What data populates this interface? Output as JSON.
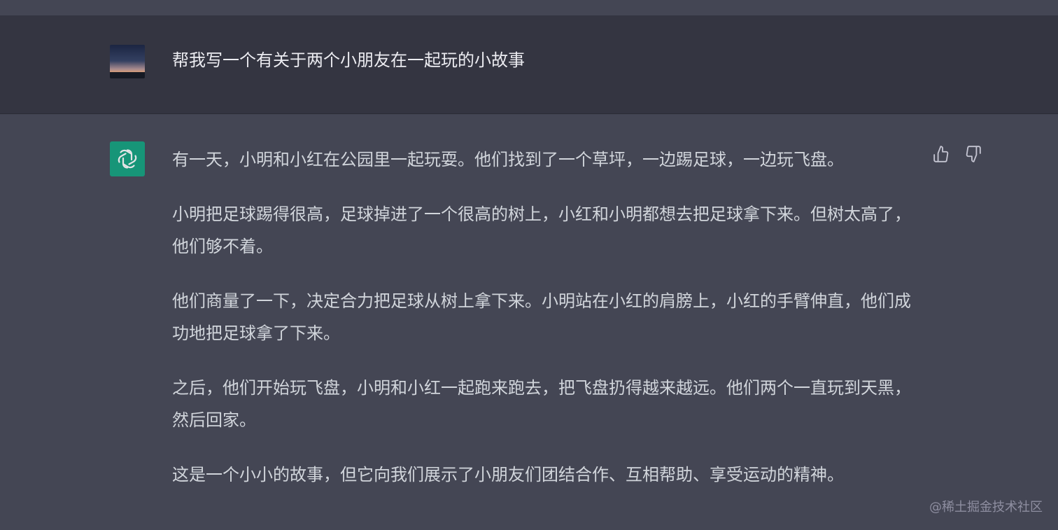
{
  "user_message": {
    "text": "帮我写一个有关于两个小朋友在一起玩的小故事",
    "avatar_icon": "sunset-avatar"
  },
  "assistant_message": {
    "avatar_icon": "openai-logo-icon",
    "paragraphs": [
      "有一天，小明和小红在公园里一起玩耍。他们找到了一个草坪，一边踢足球，一边玩飞盘。",
      "小明把足球踢得很高，足球掉进了一个很高的树上，小红和小明都想去把足球拿下来。但树太高了，他们够不着。",
      "他们商量了一下，决定合力把足球从树上拿下来。小明站在小红的肩膀上，小红的手臂伸直，他们成功地把足球拿了下来。",
      "之后，他们开始玩飞盘，小明和小红一起跑来跑去，把飞盘扔得越来越远。他们两个一直玩到天黑，然后回家。",
      "这是一个小小的故事，但它向我们展示了小朋友们团结合作、互相帮助、享受运动的精神。"
    ],
    "feedback": {
      "thumbs_up_icon": "thumbs-up-icon",
      "thumbs_down_icon": "thumbs-down-icon"
    }
  },
  "watermark": "@稀土掘金技术社区",
  "colors": {
    "user_row_bg": "#343541",
    "assistant_row_bg": "#444654",
    "openai_green": "#10a37f",
    "text_primary": "#ececf1",
    "text_secondary": "#d1d5db"
  }
}
